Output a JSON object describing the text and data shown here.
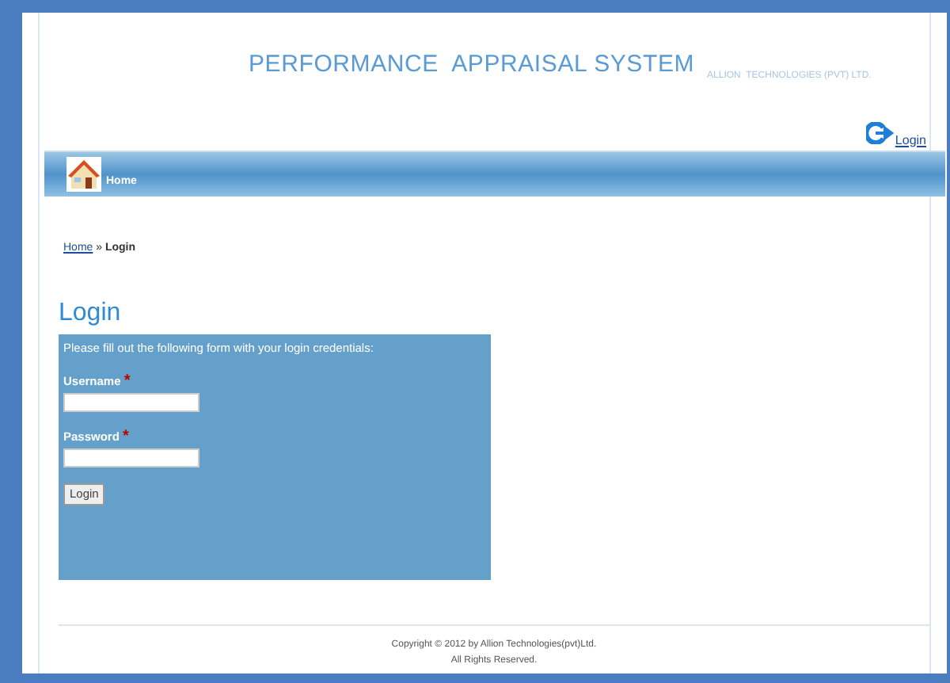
{
  "header": {
    "title": "PERFORMANCE  APPRAISAL SYSTEM",
    "company": "ALLION  TECHNOLOGIES (PVT) LTD.",
    "login_link": "Login"
  },
  "nav": {
    "items": [
      {
        "label": "Home"
      }
    ]
  },
  "breadcrumb": {
    "link": "Home",
    "separator": "»",
    "current": "Login"
  },
  "page_title": "Login",
  "form": {
    "intro": "Please fill out the following form with your login credentials:",
    "fields": [
      {
        "label": "Username",
        "required_mark": "*"
      },
      {
        "label": "Password",
        "required_mark": "*"
      }
    ],
    "submit": "Login"
  },
  "footer": {
    "lines": [
      "Copyright © 2012 by Allion Technologies(pvt)Ltd.",
      "All Rights Reserved."
    ]
  }
}
